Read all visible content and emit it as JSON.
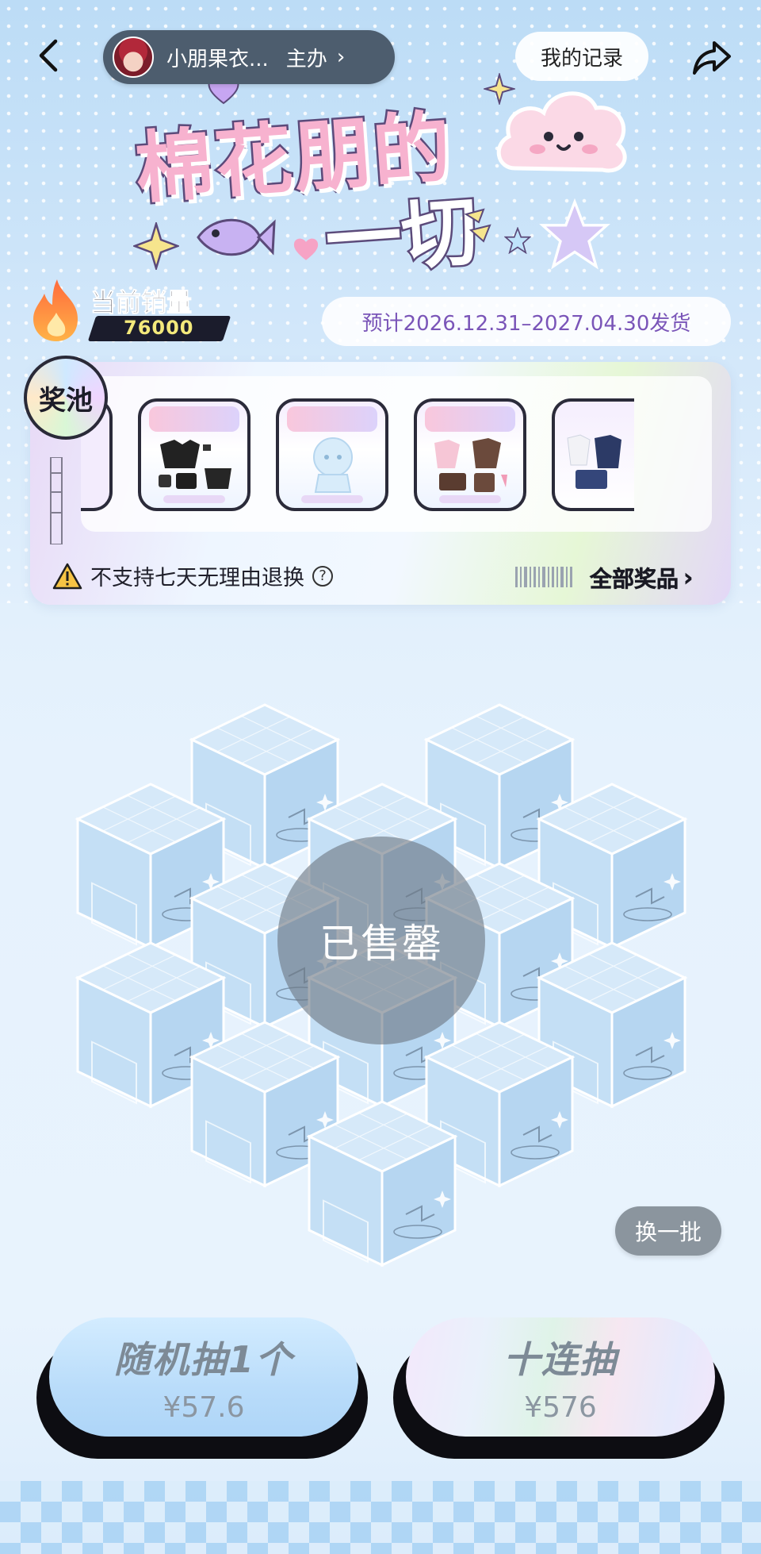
{
  "header": {
    "creator_name": "小朋果衣...",
    "creator_role": "主办",
    "records_label": "我的记录",
    "back_icon": "back-arrow-icon",
    "share_icon": "share-icon"
  },
  "banner": {
    "title_line1": "棉花朋的",
    "title_line2": "一切"
  },
  "sales": {
    "label": "当前销量",
    "value": "76000"
  },
  "shipping": {
    "text": "预计2026.12.31–2027.04.30发货"
  },
  "prize_pool": {
    "badge": "奖池",
    "notice": "不支持七天无理由退换",
    "all_prizes_label": "全部奖品",
    "prize_count_visible": 5
  },
  "boxes": {
    "soldout_label": "已售罄",
    "refresh_label": "换一批"
  },
  "draw": {
    "single_label": "随机抽1个",
    "single_price": "¥57.6",
    "ten_label": "十连抽",
    "ten_price": "¥576"
  },
  "colors": {
    "accent_purple": "#7a55b8",
    "sales_value": "#f3e97b",
    "title_pink": "#f7b2cf"
  }
}
